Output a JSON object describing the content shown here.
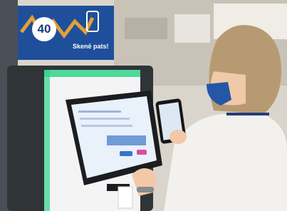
{
  "scene": {
    "kiosk": {
      "accent_color": "#2fd38a",
      "body_color": "#2f3438"
    },
    "sign": {
      "number": "40",
      "text": "Skenē pats!",
      "bg_color": "#1f4f9b",
      "line_color": "#e2a232"
    },
    "person": {
      "jacket_color": "#f3f1ee",
      "mask_color": "#2457a6",
      "hair_color": "#b79a72"
    }
  }
}
